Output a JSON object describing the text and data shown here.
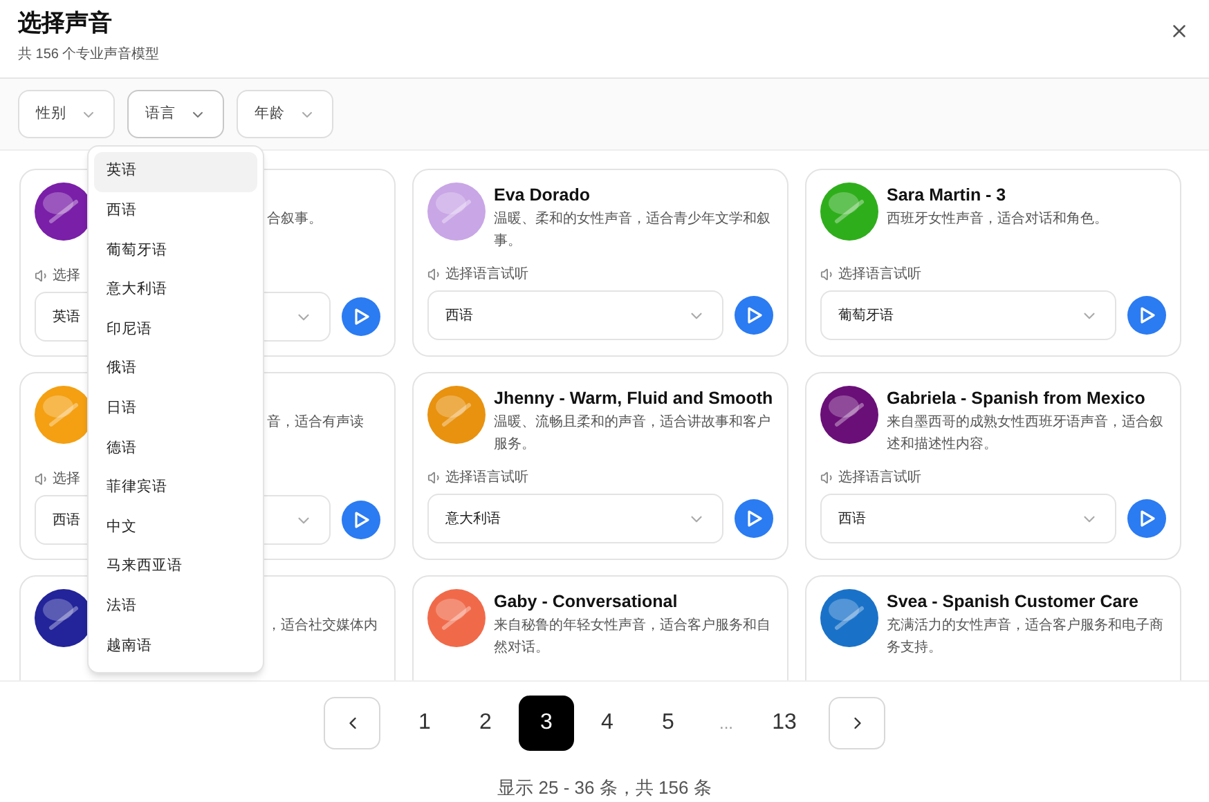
{
  "header": {
    "title": "选择声音",
    "subtitle": "共 156 个专业声音模型"
  },
  "filters": [
    {
      "label": "性别",
      "expanded": false
    },
    {
      "label": "语言",
      "expanded": true
    },
    {
      "label": "年龄",
      "expanded": false
    }
  ],
  "language_menu": [
    {
      "label": "英语",
      "selected": true
    },
    {
      "label": "西语",
      "selected": false
    },
    {
      "label": "葡萄牙语",
      "selected": false
    },
    {
      "label": "意大利语",
      "selected": false
    },
    {
      "label": "印尼语",
      "selected": false
    },
    {
      "label": "俄语",
      "selected": false
    },
    {
      "label": "日语",
      "selected": false
    },
    {
      "label": "德语",
      "selected": false
    },
    {
      "label": "菲律宾语",
      "selected": false
    },
    {
      "label": "中文",
      "selected": false
    },
    {
      "label": "马来西亚语",
      "selected": false
    },
    {
      "label": "法语",
      "selected": false
    },
    {
      "label": "越南语",
      "selected": false
    }
  ],
  "voices": [
    {
      "kind": "covered",
      "color": "#7a1fa8",
      "description": "合叙事。",
      "preview_label": "选择",
      "language": "英语"
    },
    {
      "kind": "full",
      "color": "#c9a6e6",
      "name": "Eva Dorado",
      "description": "温暖、柔和的女性声音，适合青少年文学和叙事。",
      "preview_label": "选择语言试听",
      "language": "西语"
    },
    {
      "kind": "full",
      "color": "#2fae1c",
      "name": "Sara Martin - 3",
      "description": "西班牙女性声音，适合对话和角色。",
      "preview_label": "选择语言试听",
      "language": "葡萄牙语"
    },
    {
      "kind": "covered",
      "color": "#f4a012",
      "description": "音，适合有声读",
      "preview_label": "选择",
      "language": "西语"
    },
    {
      "kind": "full",
      "color": "#e8920f",
      "name": "Jhenny - Warm, Fluid and Smooth",
      "description": "温暖、流畅且柔和的声音，适合讲故事和客户服务。",
      "preview_label": "选择语言试听",
      "language": "意大利语"
    },
    {
      "kind": "full",
      "color": "#6a0f78",
      "name": "Gabriela - Spanish from Mexico",
      "description": "来自墨西哥的成熟女性西班牙语声音，适合叙述和描述性内容。",
      "preview_label": "选择语言试听",
      "language": "西语"
    },
    {
      "kind": "covered",
      "color": "#23249a",
      "description": "，适合社交媒体内"
    },
    {
      "kind": "full",
      "color": "#f06a4a",
      "name": "Gaby - Conversational",
      "description": "来自秘鲁的年轻女性声音，适合客户服务和自然对话。"
    },
    {
      "kind": "full",
      "color": "#1a72c8",
      "name": "Svea - Spanish Customer Care",
      "description": "充满活力的女性声音，适合客户服务和电子商务支持。"
    }
  ],
  "pagination": {
    "pages": [
      {
        "kind": "page",
        "label": "1",
        "selected": false
      },
      {
        "kind": "page",
        "label": "2",
        "selected": false
      },
      {
        "kind": "page",
        "label": "3",
        "selected": true
      },
      {
        "kind": "page",
        "label": "4",
        "selected": false
      },
      {
        "kind": "page",
        "label": "5",
        "selected": false
      },
      {
        "kind": "ellipsis",
        "label": "..."
      },
      {
        "kind": "page",
        "label": "13",
        "selected": false
      }
    ],
    "summary": "显示 25 - 36 条，共 156 条"
  }
}
